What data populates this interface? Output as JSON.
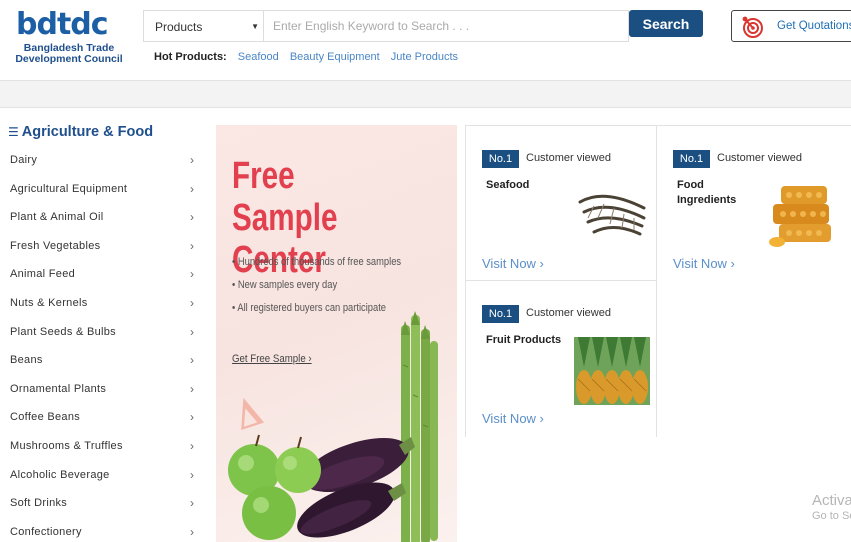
{
  "logo": {
    "mark": "bdtdc",
    "line1": "Bangladesh Trade",
    "line2": "Development Council"
  },
  "search": {
    "category": "Products",
    "placeholder": "Enter English Keyword to Search . . .",
    "button": "Search"
  },
  "quotation": {
    "label": "Get Quotations"
  },
  "hot_products": {
    "label": "Hot Products:",
    "items": [
      "Seafood",
      "Beauty Equipment",
      "Jute Products"
    ]
  },
  "sidebar": {
    "title": "Agriculture & Food",
    "items": [
      "Dairy",
      "Agricultural Equipment",
      "Plant & Animal Oil",
      "Fresh Vegetables",
      "Animal Feed",
      "Nuts & Kernels",
      "Plant Seeds & Bulbs",
      "Beans",
      "Ornamental Plants",
      "Coffee Beans",
      "Mushrooms & Truffles",
      "Alcoholic Beverage",
      "Soft Drinks",
      "Confectionery"
    ]
  },
  "banner": {
    "title_line1": "Free Sample",
    "title_line2": "Center",
    "bullets": [
      "• Hundreds of thousands of free samples",
      "• New samples every day",
      "• All registered buyers can participate"
    ],
    "cta": "Get Free Sample ›"
  },
  "cards": [
    {
      "badge": "No.1",
      "viewed": "Customer viewed",
      "name": "Seafood",
      "visit": "Visit Now ›",
      "icon": "shrimp-image"
    },
    {
      "badge": "No.1",
      "viewed": "Customer viewed",
      "name": "Food Ingredients",
      "visit": "Visit Now ›",
      "icon": "honeycomb-image"
    },
    {
      "badge": "No.1",
      "viewed": "Customer viewed",
      "name": "Fruit Products",
      "visit": "Visit Now ›",
      "icon": "pineapples-image"
    }
  ],
  "watermark": {
    "line1": "Activate Windows",
    "line2": "Go to Settings"
  },
  "colors": {
    "brand_blue": "#1b4f82",
    "link_blue": "#4a86c5",
    "banner_red": "#e2404f"
  }
}
